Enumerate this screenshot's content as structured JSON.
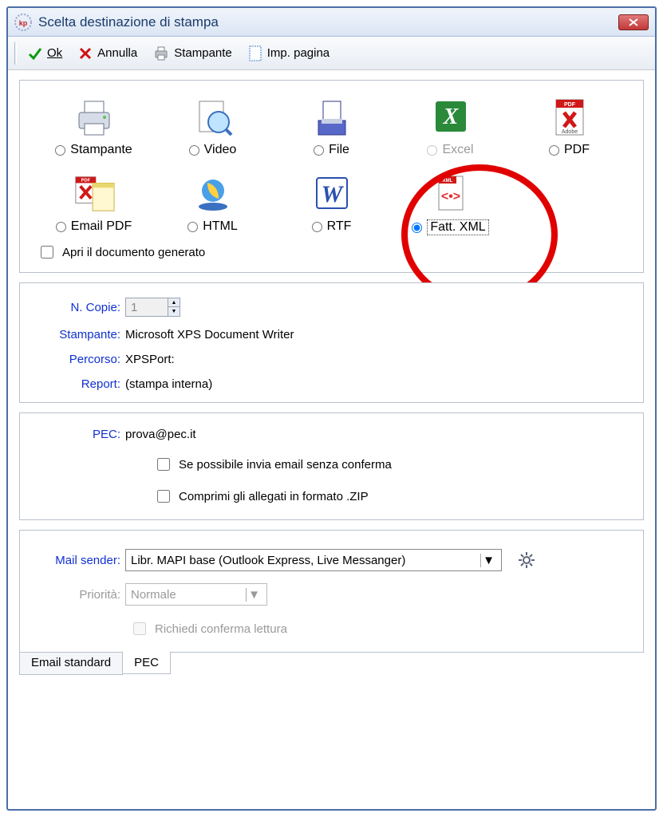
{
  "window": {
    "title": "Scelta destinazione di stampa"
  },
  "toolbar": {
    "ok": "Ok",
    "annulla": "Annulla",
    "stampante": "Stampante",
    "imp_pagina": "Imp. pagina"
  },
  "destinations": {
    "stampante": "Stampante",
    "video": "Video",
    "file": "File",
    "excel": "Excel",
    "pdf": "PDF",
    "emailpdf": "Email PDF",
    "html": "HTML",
    "rtf": "RTF",
    "fattxml": "Fatt. XML"
  },
  "open_generated": "Apri il documento generato",
  "info": {
    "ncopie_label": "N. Copie:",
    "ncopie_value": "1",
    "stampante_label": "Stampante:",
    "stampante_value": "Microsoft XPS Document Writer",
    "percorso_label": "Percorso:",
    "percorso_value": "XPSPort:",
    "report_label": "Report:",
    "report_value": "(stampa interna)"
  },
  "pec": {
    "label": "PEC:",
    "email": "prova@pec.it",
    "send_noconfirm": "Se possibile invia email senza conferma",
    "compress": "Comprimi gli allegati in formato .ZIP"
  },
  "mail": {
    "sender_label": "Mail sender:",
    "sender_value": "Libr. MAPI base (Outlook Express, Live Messanger)",
    "priorita_label": "Priorità:",
    "priorita_value": "Normale",
    "richiedi_conferma": "Richiedi conferma lettura"
  },
  "tabs": {
    "email_std": "Email standard",
    "pec": "PEC"
  }
}
